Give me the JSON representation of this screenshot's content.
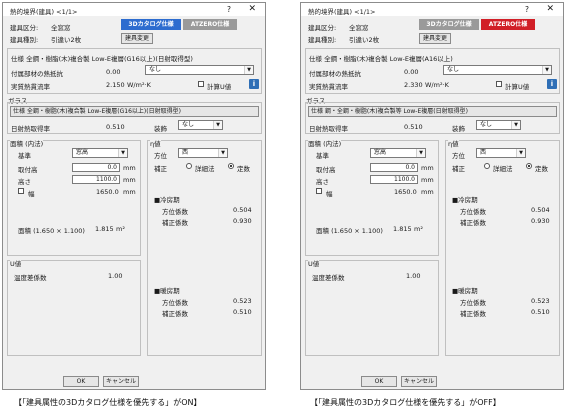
{
  "dialogs": [
    {
      "title": "熱的境界(建具) <1/1>",
      "help_label": "?",
      "close_label": "✕",
      "type_label": "建具区分:",
      "type_value": "全窓窓",
      "badge1_label": "3Dカタログ仕様",
      "badge2_label": "ATZERO仕様",
      "badge1_color": "#2d6ccf",
      "badge2_color": "#9a9a9a",
      "kind_label": "建具種別:",
      "kind_value": "引違い2枚",
      "change_label": "建具変更",
      "spec_line": "仕様  全鋼・樹脂(木)複合製 Low-E複層(G16以上)(日射取得型)",
      "frame_label": "付属部材の熱抵抗",
      "frame_value": "0.00",
      "frame_select": "なし",
      "ua_label": "実質熱貫流率",
      "ua_value": "2.150",
      "ua_unit": "W/m²·K",
      "calc_label": "計算U値",
      "glass_title": "ガラス",
      "glass_spec": "仕様  全鋼・樹脂(木)複合製 Low-E複層(G16以上)(日射取得型)",
      "solar_label": "日射熱取得率",
      "solar_value": "0.510",
      "equip_label": "装飾",
      "equip_value": "なし",
      "area_title": "面積 (内法)",
      "basis_label": "基準",
      "basis_value": "窓高",
      "height1_label": "取付高",
      "height1_value": "0.0",
      "height2_label": "高さ",
      "height2_value": "1100.0",
      "width_label": "幅",
      "width_value": "1650.0",
      "mm": "mm",
      "area_line": "面積 (1.650 × 1.100)",
      "area_value": "1.815",
      "area_unit": "m²",
      "eta_title": "η値",
      "dir_label": "方位",
      "dir_value": "西",
      "corr_label": "補正",
      "radio1_label": "詳細法",
      "radio2_label": "定数",
      "cool_title": "■冷房期",
      "cool_dir_label": "方位係数",
      "cool_dir_value": "0.504",
      "cool_corr_label": "補正係数",
      "cool_corr_value": "0.930",
      "u_title": "U値",
      "temp_label": "温度差係数",
      "temp_value": "1.00",
      "heat_title": "■暖房期",
      "heat_dir_label": "方位係数",
      "heat_dir_value": "0.523",
      "heat_corr_label": "補正係数",
      "heat_corr_value": "0.510",
      "ok_label": "OK",
      "cancel_label": "キャンセル",
      "caption": "【「建具属性の3Dカタログ仕様を優先する」がON】"
    },
    {
      "title": "熱的境界(建具) <1/1>",
      "help_label": "?",
      "close_label": "✕",
      "type_label": "建具区分:",
      "type_value": "全窓窓",
      "badge1_label": "3Dカタログ仕様",
      "badge2_label": "ATZERO仕様",
      "badge1_color": "#9a9a9a",
      "badge2_color": "#d11f27",
      "kind_label": "建具種別:",
      "kind_value": "引違い2枚",
      "change_label": "建具変更",
      "spec_line": "仕様  全鋼・樹脂(木)複合製 Low-E複層(A16以上)",
      "frame_label": "付属部材の熱抵抗",
      "frame_value": "0.00",
      "frame_select": "なし",
      "ua_label": "実質熱貫流率",
      "ua_value": "2.330",
      "ua_unit": "W/m²·K",
      "calc_label": "計算U値",
      "glass_title": "ガラス",
      "glass_spec": "仕様  鋼・全鋼・樹脂(木)複合製等 Low-E複層(日射取得型)",
      "solar_label": "日射熱取得率",
      "solar_value": "0.510",
      "equip_label": "装飾",
      "equip_value": "なし",
      "area_title": "面積 (内法)",
      "basis_label": "基準",
      "basis_value": "窓高",
      "height1_label": "取付高",
      "height1_value": "0.0",
      "height2_label": "高さ",
      "height2_value": "1100.0",
      "width_label": "幅",
      "width_value": "1650.0",
      "mm": "mm",
      "area_line": "面積 (1.650 × 1.100)",
      "area_value": "1.815",
      "area_unit": "m²",
      "eta_title": "η値",
      "dir_label": "方位",
      "dir_value": "西",
      "corr_label": "補正",
      "radio1_label": "詳細法",
      "radio2_label": "定数",
      "cool_title": "■冷房期",
      "cool_dir_label": "方位係数",
      "cool_dir_value": "0.504",
      "cool_corr_label": "補正係数",
      "cool_corr_value": "0.930",
      "u_title": "U値",
      "temp_label": "温度差係数",
      "temp_value": "1.00",
      "heat_title": "■暖房期",
      "heat_dir_label": "方位係数",
      "heat_dir_value": "0.523",
      "heat_corr_label": "補正係数",
      "heat_corr_value": "0.510",
      "ok_label": "OK",
      "cancel_label": "キャンセル",
      "caption": "【「建具属性の3Dカタログ仕様を優先する」がOFF】"
    }
  ]
}
